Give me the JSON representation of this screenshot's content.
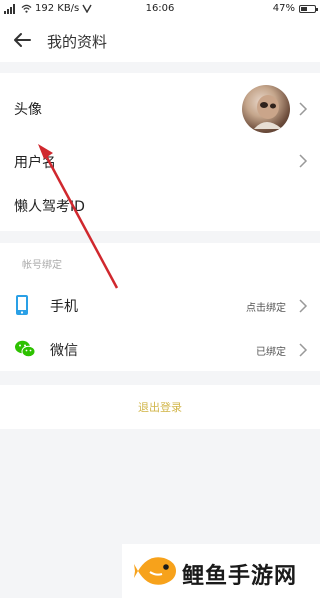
{
  "status_bar": {
    "speed": "192 KB/s",
    "time": "16:06",
    "battery": "47%",
    "battery_level": 0.47
  },
  "header": {
    "title": "我的资料"
  },
  "profile": {
    "avatar_label": "头像",
    "username_label": "用户名",
    "id_label": "懒人驾考ID"
  },
  "binding": {
    "section_title": "帐号绑定",
    "phone": {
      "label": "手机",
      "value": "点击绑定"
    },
    "wechat": {
      "label": "微信",
      "value": "已绑定"
    }
  },
  "logout": {
    "label": "退出登录"
  },
  "watermark": {
    "text": "鲤鱼手游网"
  },
  "colors": {
    "logout_text": "#d2b64a",
    "phone_icon": "#2aa0e6",
    "wechat_icon": "#2dc100",
    "annotation_arrow": "#d0282e",
    "watermark_fish": "#f7a21b"
  },
  "icons": [
    "back-arrow-icon",
    "chevron-right-icon",
    "phone-icon",
    "wechat-icon",
    "fish-logo-icon"
  ]
}
